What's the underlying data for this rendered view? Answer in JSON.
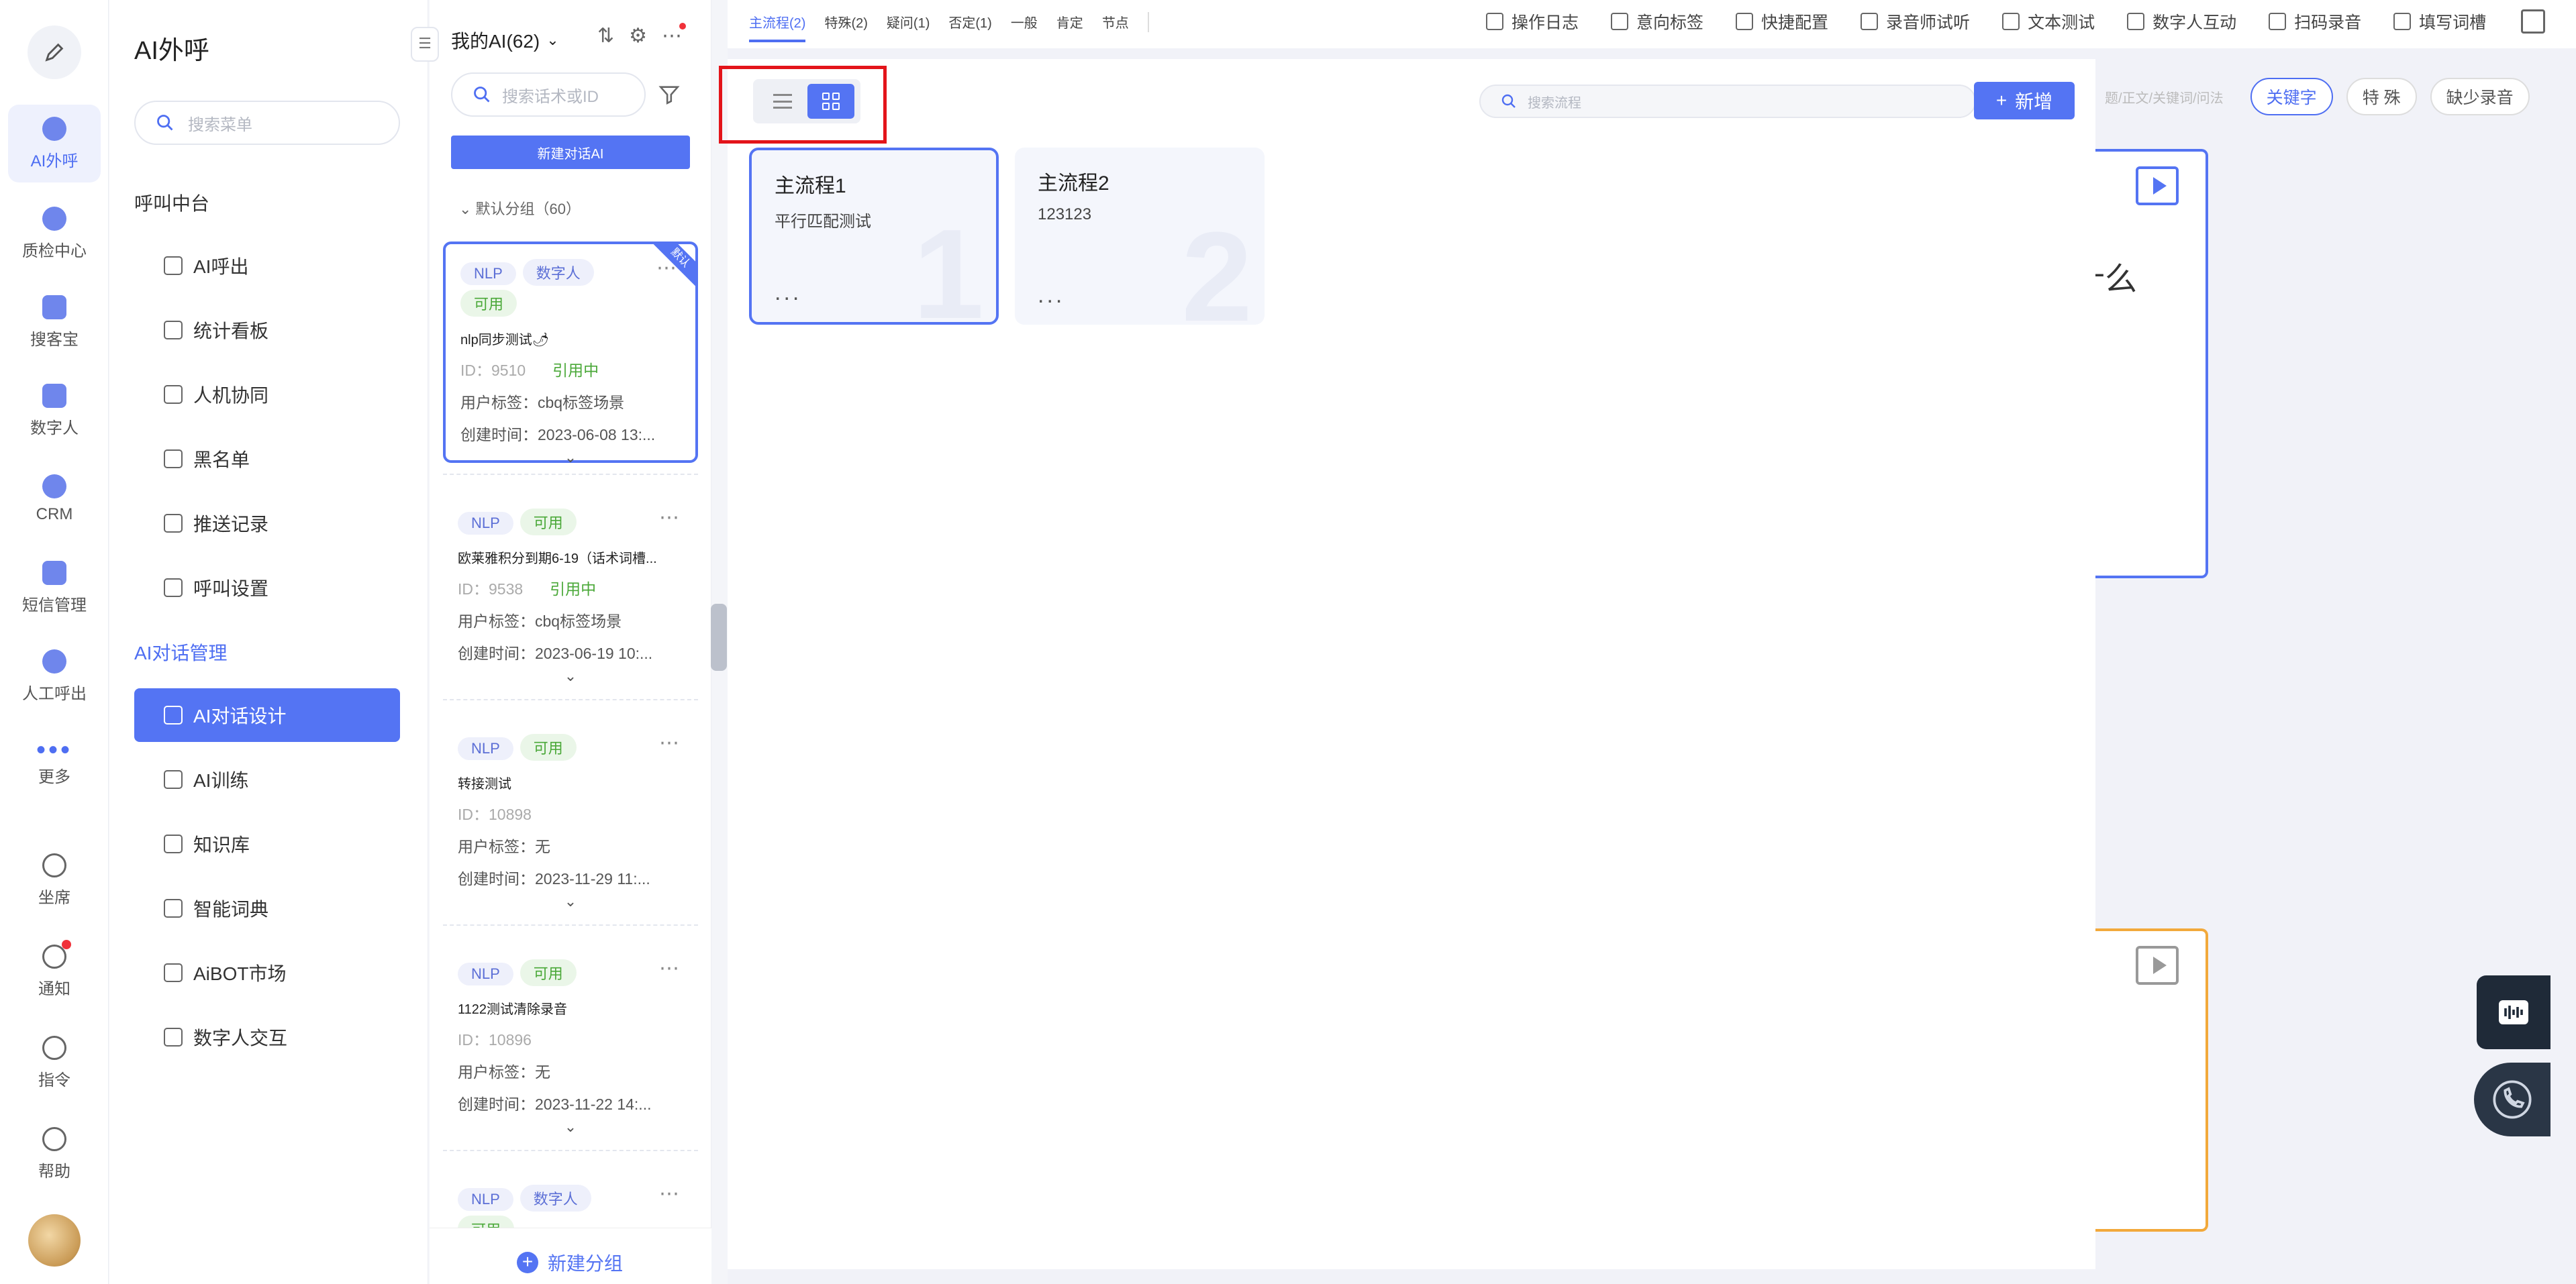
{
  "rail": {
    "items": [
      {
        "label": "AI外呼",
        "icon": "robot-icon"
      },
      {
        "label": "质检中心",
        "icon": "shield-check-icon"
      },
      {
        "label": "搜客宝",
        "icon": "phone-icon"
      },
      {
        "label": "数字人",
        "icon": "tv-icon"
      },
      {
        "label": "CRM",
        "icon": "user-icon"
      },
      {
        "label": "短信管理",
        "icon": "message-icon"
      },
      {
        "label": "人工呼出",
        "icon": "headset-icon"
      },
      {
        "label": "更多",
        "icon": "more-icon"
      },
      {
        "label": "坐席",
        "icon": "agent-icon"
      },
      {
        "label": "通知",
        "icon": "bell-icon"
      },
      {
        "label": "指令",
        "icon": "pin-icon"
      },
      {
        "label": "帮助",
        "icon": "help-icon"
      }
    ]
  },
  "menu": {
    "title": "AI外呼",
    "search_placeholder": "搜索菜单",
    "section1": "呼叫中台",
    "section1_items": [
      "AI呼出",
      "统计看板",
      "人机协同",
      "黑名单",
      "推送记录",
      "呼叫设置"
    ],
    "section2": "AI对话管理",
    "section2_items": [
      "AI对话设计",
      "AI训练",
      "知识库",
      "智能词典",
      "AiBOT市场",
      "数字人交互"
    ]
  },
  "ai_list": {
    "header": "我的AI(62)",
    "search_placeholder": "搜索话术或ID",
    "new_button": "新建对话AI",
    "group": "默认分组（60）",
    "add_group": "新建分组",
    "cards": [
      {
        "tags": [
          "NLP",
          "数字人",
          "可用"
        ],
        "name": "nlp同步测试🌶",
        "id": "ID：9510",
        "ref": "引用中",
        "label": "用户标签：cbq标签场景",
        "created": "创建时间：2023-06-08 13:...",
        "ribbon": "默认"
      },
      {
        "tags": [
          "NLP",
          "可用"
        ],
        "name": "欧莱雅积分到期6-19（话术词槽...",
        "id": "ID：9538",
        "ref": "引用中",
        "label": "用户标签：cbq标签场景",
        "created": "创建时间：2023-06-19 10:..."
      },
      {
        "tags": [
          "NLP",
          "可用"
        ],
        "name": "转接测试",
        "id": "ID：10898",
        "label": "用户标签：无",
        "created": "创建时间：2023-11-29 11:..."
      },
      {
        "tags": [
          "NLP",
          "可用"
        ],
        "name": "1122测试清除录音",
        "id": "ID：10896",
        "label": "用户标签：无",
        "created": "创建时间：2023-11-22 14:..."
      },
      {
        "tags": [
          "NLP",
          "数字人",
          "可用"
        ]
      }
    ]
  },
  "topbar": {
    "flow_tabs": [
      "主流程(2)",
      "特殊(2)",
      "疑问(1)",
      "否定(1)",
      "一般",
      "肯定",
      "节点"
    ],
    "tools": [
      "操作日志",
      "意向标签",
      "快捷配置",
      "录音师试听",
      "文本测试",
      "数字人互动",
      "扫码录音",
      "填写词槽"
    ]
  },
  "background": {
    "keyword_placeholder": "题/正文/关键词/问法",
    "pills": [
      "关键字",
      "特 殊",
      "缺少录音"
    ],
    "partial_text": "有什么"
  },
  "overlay": {
    "search_placeholder": "搜索流程",
    "add_label": "新增",
    "flows": [
      {
        "name": "主流程1",
        "desc": "平行匹配测试",
        "num": "1",
        "more": "..."
      },
      {
        "name": "主流程2",
        "desc": "123123",
        "num": "2",
        "more": "..."
      }
    ]
  },
  "colors": {
    "accent": "#5474f3",
    "highlight": "#e3141a",
    "success": "#4aa838"
  }
}
